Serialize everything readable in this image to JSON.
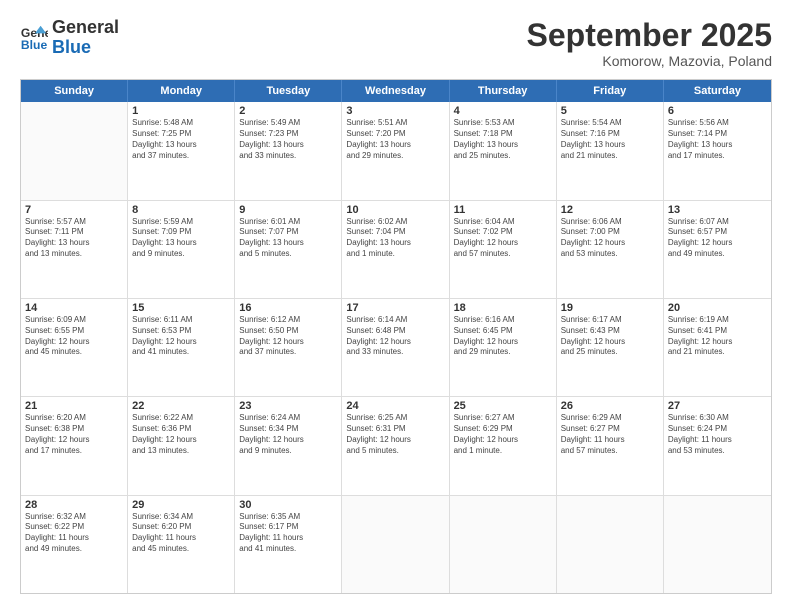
{
  "header": {
    "logo_general": "General",
    "logo_blue": "Blue",
    "month_title": "September 2025",
    "location": "Komorow, Mazovia, Poland"
  },
  "days_of_week": [
    "Sunday",
    "Monday",
    "Tuesday",
    "Wednesday",
    "Thursday",
    "Friday",
    "Saturday"
  ],
  "weeks": [
    [
      {
        "day": "",
        "detail": ""
      },
      {
        "day": "1",
        "detail": "Sunrise: 5:48 AM\nSunset: 7:25 PM\nDaylight: 13 hours\nand 37 minutes."
      },
      {
        "day": "2",
        "detail": "Sunrise: 5:49 AM\nSunset: 7:23 PM\nDaylight: 13 hours\nand 33 minutes."
      },
      {
        "day": "3",
        "detail": "Sunrise: 5:51 AM\nSunset: 7:20 PM\nDaylight: 13 hours\nand 29 minutes."
      },
      {
        "day": "4",
        "detail": "Sunrise: 5:53 AM\nSunset: 7:18 PM\nDaylight: 13 hours\nand 25 minutes."
      },
      {
        "day": "5",
        "detail": "Sunrise: 5:54 AM\nSunset: 7:16 PM\nDaylight: 13 hours\nand 21 minutes."
      },
      {
        "day": "6",
        "detail": "Sunrise: 5:56 AM\nSunset: 7:14 PM\nDaylight: 13 hours\nand 17 minutes."
      }
    ],
    [
      {
        "day": "7",
        "detail": "Sunrise: 5:57 AM\nSunset: 7:11 PM\nDaylight: 13 hours\nand 13 minutes."
      },
      {
        "day": "8",
        "detail": "Sunrise: 5:59 AM\nSunset: 7:09 PM\nDaylight: 13 hours\nand 9 minutes."
      },
      {
        "day": "9",
        "detail": "Sunrise: 6:01 AM\nSunset: 7:07 PM\nDaylight: 13 hours\nand 5 minutes."
      },
      {
        "day": "10",
        "detail": "Sunrise: 6:02 AM\nSunset: 7:04 PM\nDaylight: 13 hours\nand 1 minute."
      },
      {
        "day": "11",
        "detail": "Sunrise: 6:04 AM\nSunset: 7:02 PM\nDaylight: 12 hours\nand 57 minutes."
      },
      {
        "day": "12",
        "detail": "Sunrise: 6:06 AM\nSunset: 7:00 PM\nDaylight: 12 hours\nand 53 minutes."
      },
      {
        "day": "13",
        "detail": "Sunrise: 6:07 AM\nSunset: 6:57 PM\nDaylight: 12 hours\nand 49 minutes."
      }
    ],
    [
      {
        "day": "14",
        "detail": "Sunrise: 6:09 AM\nSunset: 6:55 PM\nDaylight: 12 hours\nand 45 minutes."
      },
      {
        "day": "15",
        "detail": "Sunrise: 6:11 AM\nSunset: 6:53 PM\nDaylight: 12 hours\nand 41 minutes."
      },
      {
        "day": "16",
        "detail": "Sunrise: 6:12 AM\nSunset: 6:50 PM\nDaylight: 12 hours\nand 37 minutes."
      },
      {
        "day": "17",
        "detail": "Sunrise: 6:14 AM\nSunset: 6:48 PM\nDaylight: 12 hours\nand 33 minutes."
      },
      {
        "day": "18",
        "detail": "Sunrise: 6:16 AM\nSunset: 6:45 PM\nDaylight: 12 hours\nand 29 minutes."
      },
      {
        "day": "19",
        "detail": "Sunrise: 6:17 AM\nSunset: 6:43 PM\nDaylight: 12 hours\nand 25 minutes."
      },
      {
        "day": "20",
        "detail": "Sunrise: 6:19 AM\nSunset: 6:41 PM\nDaylight: 12 hours\nand 21 minutes."
      }
    ],
    [
      {
        "day": "21",
        "detail": "Sunrise: 6:20 AM\nSunset: 6:38 PM\nDaylight: 12 hours\nand 17 minutes."
      },
      {
        "day": "22",
        "detail": "Sunrise: 6:22 AM\nSunset: 6:36 PM\nDaylight: 12 hours\nand 13 minutes."
      },
      {
        "day": "23",
        "detail": "Sunrise: 6:24 AM\nSunset: 6:34 PM\nDaylight: 12 hours\nand 9 minutes."
      },
      {
        "day": "24",
        "detail": "Sunrise: 6:25 AM\nSunset: 6:31 PM\nDaylight: 12 hours\nand 5 minutes."
      },
      {
        "day": "25",
        "detail": "Sunrise: 6:27 AM\nSunset: 6:29 PM\nDaylight: 12 hours\nand 1 minute."
      },
      {
        "day": "26",
        "detail": "Sunrise: 6:29 AM\nSunset: 6:27 PM\nDaylight: 11 hours\nand 57 minutes."
      },
      {
        "day": "27",
        "detail": "Sunrise: 6:30 AM\nSunset: 6:24 PM\nDaylight: 11 hours\nand 53 minutes."
      }
    ],
    [
      {
        "day": "28",
        "detail": "Sunrise: 6:32 AM\nSunset: 6:22 PM\nDaylight: 11 hours\nand 49 minutes."
      },
      {
        "day": "29",
        "detail": "Sunrise: 6:34 AM\nSunset: 6:20 PM\nDaylight: 11 hours\nand 45 minutes."
      },
      {
        "day": "30",
        "detail": "Sunrise: 6:35 AM\nSunset: 6:17 PM\nDaylight: 11 hours\nand 41 minutes."
      },
      {
        "day": "",
        "detail": ""
      },
      {
        "day": "",
        "detail": ""
      },
      {
        "day": "",
        "detail": ""
      },
      {
        "day": "",
        "detail": ""
      }
    ]
  ]
}
